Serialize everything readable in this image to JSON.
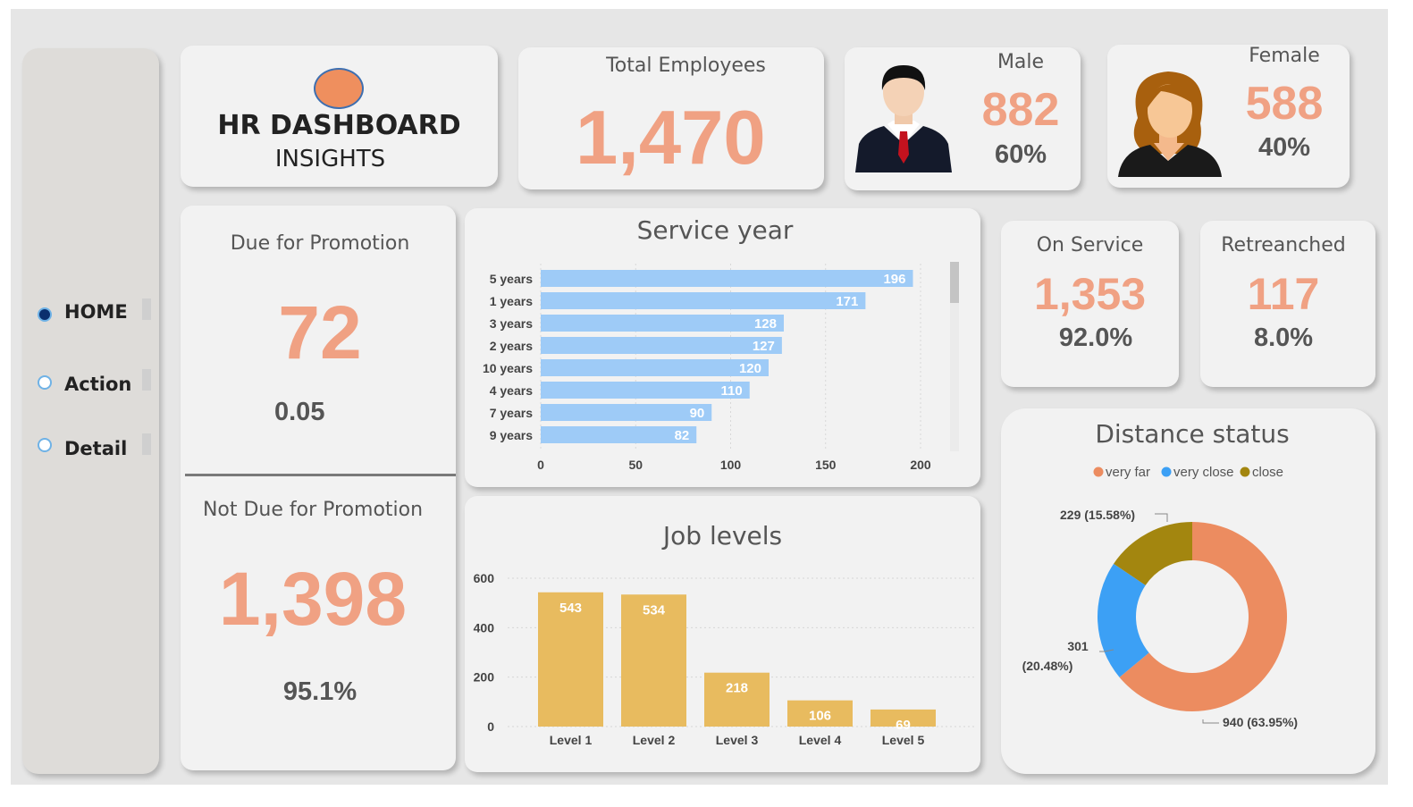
{
  "nav": {
    "items": [
      {
        "label": "HOME",
        "selected": true
      },
      {
        "label": "Action",
        "selected": false
      },
      {
        "label": "Detail",
        "selected": false
      }
    ]
  },
  "header": {
    "title": "HR DASHBOARD",
    "subtitle": "INSIGHTS",
    "logo_color": "#ef8f5e"
  },
  "kpis": {
    "total": {
      "label": "Total Employees",
      "value": "1,470"
    },
    "male": {
      "label": "Male",
      "value": "882",
      "pct": "60%"
    },
    "female": {
      "label": "Female",
      "value": "588",
      "pct": "40%"
    },
    "due": {
      "label": "Due for Promotion",
      "value": "72",
      "sub": "0.05"
    },
    "not_due": {
      "label": "Not Due for Promotion",
      "value": "1,398",
      "sub": "95.1%"
    },
    "on_service": {
      "label": "On Service",
      "value": "1,353",
      "pct": "92.0%"
    },
    "retrenched": {
      "label": "Retreanched",
      "value": "117",
      "pct": "8.0%"
    }
  },
  "colors": {
    "accent": "#f0a183",
    "service_bar": "#9ecbf7",
    "job_bar": "#e8bb5f",
    "very_far": "#ec8c60",
    "very_close": "#3ca0f5",
    "close": "#a3860f"
  },
  "chart_data": [
    {
      "type": "bar",
      "orientation": "horizontal",
      "title": "Service year",
      "categories": [
        "5 years",
        "1 years",
        "3 years",
        "2 years",
        "10 years",
        "4 years",
        "7 years",
        "9 years"
      ],
      "values": [
        196,
        171,
        128,
        127,
        120,
        110,
        90,
        82
      ],
      "xlim": [
        0,
        200
      ],
      "xticks": [
        "0",
        "50",
        "100",
        "150",
        "200"
      ],
      "grid": true,
      "data_labels": true
    },
    {
      "type": "bar",
      "title": "Job levels",
      "categories": [
        "Level 1",
        "Level 2",
        "Level 3",
        "Level 4",
        "Level 5"
      ],
      "values": [
        543,
        534,
        218,
        106,
        69
      ],
      "ylim": [
        0,
        600
      ],
      "yticks": [
        "0",
        "200",
        "400",
        "600"
      ],
      "grid": true,
      "data_labels": true
    },
    {
      "type": "pie",
      "donut": true,
      "title": "Distance status",
      "legend_position": "top",
      "slices": [
        {
          "name": "very far",
          "value": 940,
          "label": "940 (63.95%)"
        },
        {
          "name": "very close",
          "value": 301,
          "label": "301 (20.48%)"
        },
        {
          "name": "close",
          "value": 229,
          "label": "229 (15.58%)"
        }
      ]
    }
  ]
}
